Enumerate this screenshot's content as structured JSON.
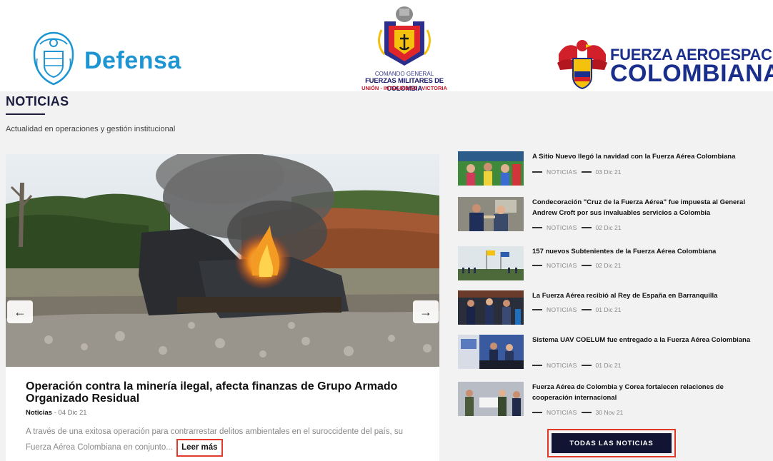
{
  "header": {
    "logo_defensa": {
      "text": "Defensa"
    },
    "logo_cgfm": {
      "line1": "COMANDO GENERAL",
      "line2": "FUERZAS MILITARES DE COLOMBIA",
      "line3": "UNIÓN - INTEGRIDAD - VICTORIA"
    },
    "logo_fac": {
      "line1": "FUERZA AEROESPACIAL",
      "line2": "COLOMBIANA"
    }
  },
  "section": {
    "title": "NOTICIAS",
    "subtitle": "Actualidad en operaciones y gestión institucional"
  },
  "featured": {
    "prev_arrow": "←",
    "next_arrow": "→",
    "title": "Operación contra la minería ilegal, afecta finanzas de Grupo Armado Organizado Residual",
    "category": "Noticias",
    "date": " - 04 Dic 21",
    "excerpt": "A través de una exitosa operación para contrarrestar delitos ambientales en el suroccidente del país, su Fuerza Aérea Colombiana en conjunto...",
    "read_more": "Leer más"
  },
  "news_list": [
    {
      "title": "A Sitio Nuevo llegó la navidad con la Fuerza Aérea Colombiana",
      "category": "NOTICIAS",
      "date": "03 Dic 21",
      "thumb": "children-christmas"
    },
    {
      "title": "Condecoración \"Cruz de la Fuerza Aérea\" fue impuesta al General Andrew Croft por sus invaluables servicios a Colombia",
      "category": "NOTICIAS",
      "date": "02 Dic 21",
      "thumb": "ceremony-handshake"
    },
    {
      "title": "157 nuevos Subtenientes de la Fuerza Aérea Colombiana",
      "category": "NOTICIAS",
      "date": "02 Dic 21",
      "thumb": "flags-parade"
    },
    {
      "title": "La Fuerza Aérea recibió al Rey de España en Barranquilla",
      "category": "NOTICIAS",
      "date": "01 Dic 21",
      "thumb": "royal-visit"
    },
    {
      "title": "Sistema UAV COELUM fue entregado a la Fuerza Aérea Colombiana",
      "category": "NOTICIAS",
      "date": "01 Dic 21",
      "thumb": "uav-delivery"
    },
    {
      "title": "Fuerza Aérea de Colombia y Corea fortalecen relaciones de cooperación internacional",
      "category": "NOTICIAS",
      "date": "30 Nov 21",
      "thumb": "korea-meeting"
    }
  ],
  "all_news_button": "TODAS LAS NOTICIAS",
  "colors": {
    "defensa_blue": "#1d95d3",
    "fac_blue": "#1a2e8c",
    "button_navy": "#111533",
    "highlight_red": "#e23a2a"
  }
}
